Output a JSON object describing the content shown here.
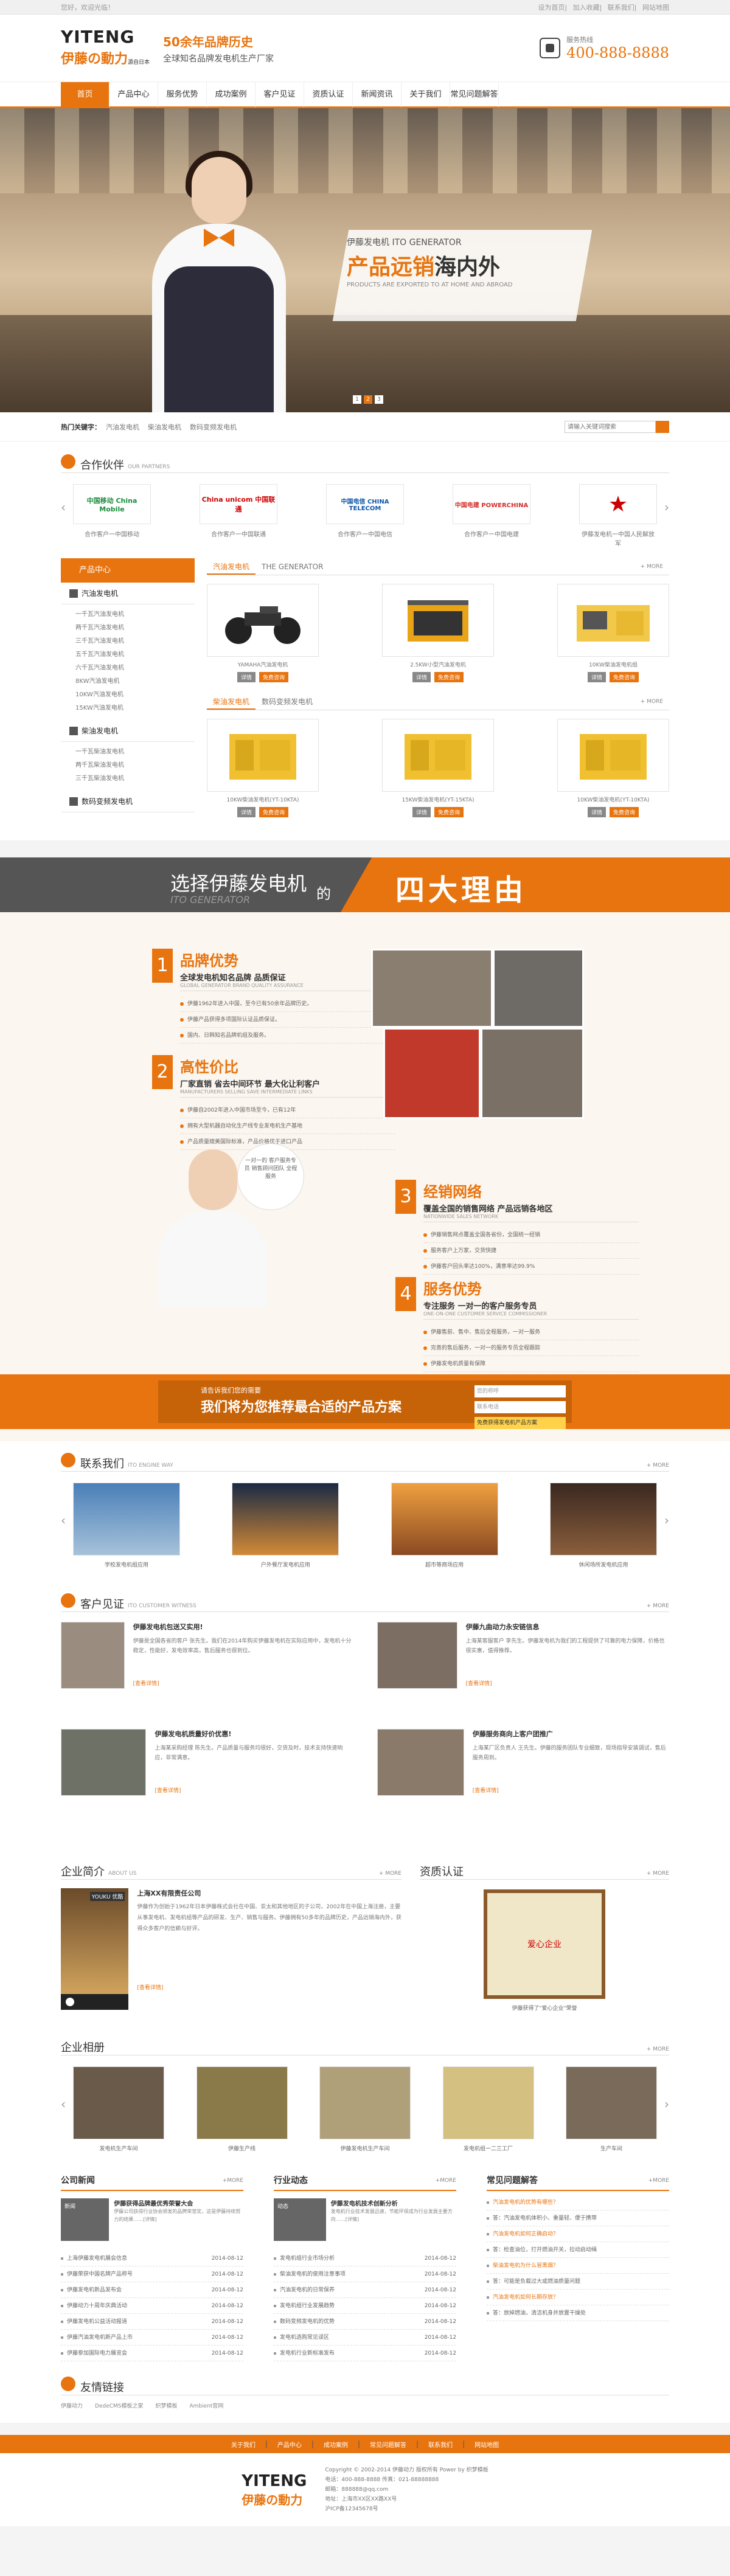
{
  "topbar": {
    "welcome": "您好，欢迎光临！",
    "links": [
      "设为首页",
      "加入收藏",
      "联系我们",
      "网站地图"
    ]
  },
  "header": {
    "logo_en": "YITENG",
    "logo_cn": "伊藤の動力",
    "logo_sub": "源自日本",
    "slogan1": "50余年品牌历史",
    "slogan2": "全球知名品牌发电机生产厂家",
    "tel_label": "服务热线",
    "tel": "400-888-8888"
  },
  "nav": [
    "首页",
    "产品中心",
    "服务优势",
    "成功案例",
    "客户见证",
    "资质认证",
    "新闻资讯",
    "关于我们",
    "常见问题解答"
  ],
  "banner": {
    "small": "伊藤发电机 ITO GENERATOR",
    "big_orange": "产品远销",
    "big_dark": "海内外",
    "en": "PRODUCTS ARE EXPORTED TO AT HOME AND ABROAD",
    "dots": [
      "1",
      "2",
      "3"
    ]
  },
  "hot": {
    "label": "热门关键字：",
    "keywords": [
      "汽油发电机",
      "柴油发电机",
      "数码变频发电机"
    ],
    "placeholder": "请输入关键词搜索"
  },
  "partners": {
    "title": "合作伙伴",
    "en": "OUR PARTNERS",
    "items": [
      {
        "logo": "中国移动 China Mobile",
        "cap": "合作客户一中国移动"
      },
      {
        "logo": "China unicom 中国联通",
        "cap": "合作客户一中国联通"
      },
      {
        "logo": "中国电信 CHINA TELECOM",
        "cap": "合作客户一中国电信"
      },
      {
        "logo": "中国电建 POWERCHINA",
        "cap": "合作客户一中国电建"
      },
      {
        "logo": "★",
        "cap": "伊藤发电机一中国人民解放军"
      }
    ]
  },
  "products": {
    "side_title": "产品中心",
    "cats": [
      {
        "name": "汽油发电机",
        "subs": [
          "一千瓦汽油发电机",
          "两千瓦汽油发电机",
          "三千瓦汽油发电机",
          "五千瓦汽油发电机",
          "六千瓦汽油发电机",
          "8KW汽油发电机",
          "10KW汽油发电机",
          "15KW汽油发电机"
        ]
      },
      {
        "name": "柴油发电机",
        "subs": [
          "一千瓦柴油发电机",
          "两千瓦柴油发电机",
          "三千瓦柴油发电机"
        ]
      },
      {
        "name": "数码变频发电机",
        "subs": []
      }
    ],
    "tab1": "汽油发电机",
    "tab1_en": "THE GENERATOR",
    "tab2": "柴油发电机",
    "tab2b": "数码变频发电机",
    "more": "+ MORE",
    "row1": [
      "YAMAHA汽油发电机",
      "2.5KW小型汽油发电机",
      "10KW柴油发电机组"
    ],
    "row2": [
      "10KW柴油发电机(YT-10KTA)",
      "15KW柴油发电机(YT-15KTA)",
      "10KW柴油发电机(YT-10KTA)"
    ],
    "btn1": "详情",
    "btn2": "免费咨询"
  },
  "reasons": {
    "title1": "选择伊藤发电机",
    "title2": "ITO GENERATOR",
    "de": "的",
    "big": "四大理由",
    "items": [
      {
        "num": "1",
        "title": "品牌优势",
        "sub": "全球发电机知名品牌 品质保证",
        "en": "GLOBAL GENERATOR BRAND QUALITY ASSURANCE",
        "pts": [
          "伊藤1962年进入中国，至今已有50余年品牌历史。",
          "伊藤产品获得多项国际认证品质保证。",
          "国内、日韩知名品牌机组及服务。"
        ]
      },
      {
        "num": "2",
        "title": "高性价比",
        "sub": "厂家直销 省去中间环节 最大化让利客户",
        "en": "MANUFACTURERS SELLING SAVE INTERMEDIATE LINKS",
        "pts": [
          "伊藤自2002年进入中国市场至今，已有12年",
          "拥有大型机器自动化生产线专业发电机生产基地",
          "产品质量媲美国际标准，产品价格优于进口产品"
        ]
      },
      {
        "num": "3",
        "title": "经销网络",
        "sub": "覆盖全国的销售网络 产品远销各地区",
        "en": "NATIONWIDE SALES NETWORK",
        "pts": [
          "伊藤销售网点覆盖全国各省份，全国统一经销",
          "服务客户上万家，交货快捷",
          "伊藤客户回头率达100%，满意率达99.9%"
        ]
      },
      {
        "num": "4",
        "title": "服务优势",
        "sub": "专注服务 一对一的客户服务专员",
        "en": "ONE-ON-ONE CUSTOMER SERVICE COMMISSIONER",
        "pts": [
          "伊藤售前、售中、售后全程服务，一对一服务",
          "完善的售后服务，一对一的服务专员全程跟踪",
          "伊藤发电机质量有保障"
        ]
      }
    ],
    "bubble": "一对一的 客户服务专员 销售顾问团队 全程服务",
    "cta1": "请告诉我们您的需要",
    "cta2": "我们将为您推荐最合适的产品方案",
    "form": [
      "您的称呼",
      "联系电话",
      "免费获得发电机产品方案"
    ]
  },
  "contact": {
    "title": "联系我们",
    "en": "ITO ENGINE WAY",
    "items": [
      "学校发电机组应用",
      "户外餐厅发电机应用",
      "超市等商场应用",
      "休闲场所发电机应用"
    ]
  },
  "testimonials": {
    "title": "客户见证",
    "en": "ITO CUSTOMER WITNESS",
    "items": [
      {
        "t": "伊藤发电机包送又实用!",
        "x": "伊藤是全国各省的客户 张先生。我们在2014年购买伊藤发电机在实际应用中，发电机十分稳定，性能好，发电效率高，售后服务也很到位。",
        "rm": "[查看详情]"
      },
      {
        "t": "伊藤九曲动力永安链信息",
        "x": "上海某客服客户 李先生。伊藤发电机为我们的工程提供了可靠的电力保障，价格也很实惠，值得推荐。",
        "rm": "[查看详情]"
      },
      {
        "t": "伊藤发电机质量好价优惠!",
        "x": "上海某采购经理 陈先生。产品质量与服务均很好，交货及时，技术支持快速响应，非常满意。",
        "rm": "[查看详情]"
      },
      {
        "t": "伊藤服务商向上客户团推广",
        "x": "上海某厂区负责人 王先生。伊藤的服务团队专业细致，现场指导安装调试，售后服务周到。",
        "rm": "[查看详情]"
      }
    ]
  },
  "company": {
    "title": "企业简介",
    "en": "ABOUT US",
    "more": "+ MORE",
    "name": "上海XX有限责任公司",
    "text": "伊藤作为创始于1962年日本伊藤株式会社在中国、亚太和其他地区的子公司，2002年在中国上海注册，主要从事发电机、发电机组等产品的研发、生产、销售与服务。伊藤拥有50多年的品牌历史，产品远销海内外，获得众多客户的信赖与好评。",
    "rm": "[查看详情]",
    "video_tag": "YOUKU 优酷"
  },
  "cert": {
    "title": "资质认证",
    "more": "+ MORE",
    "badge": "爱心企业",
    "cap": "伊藤获得了\"爱心企业\"荣誉"
  },
  "album": {
    "title": "企业相册",
    "more": "+ MORE",
    "items": [
      "发电机生产车间",
      "伊藤生产线",
      "伊藤发电机生产车间",
      "发电机组一二三工厂",
      "生产车间"
    ],
    "sub": "伊藤"
  },
  "news": [
    {
      "title": "公司新闻",
      "more": "+MORE",
      "top_title": "新闻",
      "top_t": "伊藤获得品牌最优秀荣誉大会",
      "top_x": "伊藤公司获得行业协会颁发的品牌荣誉奖，这是伊藤持续努力的结果……[详情]",
      "items": [
        [
          "上海伊藤发电机展会信息",
          "2014-08-12"
        ],
        [
          "伊藤荣获中国名牌产品称号",
          "2014-08-12"
        ],
        [
          "伊藤发电机新品发布会",
          "2014-08-12"
        ],
        [
          "伊藤动力十周年庆典活动",
          "2014-08-12"
        ],
        [
          "伊藤发电机公益活动报道",
          "2014-08-12"
        ],
        [
          "伊藤汽油发电机新产品上市",
          "2014-08-12"
        ],
        [
          "伊藤参加国际电力展览会",
          "2014-08-12"
        ]
      ]
    },
    {
      "title": "行业动态",
      "more": "+MORE",
      "top_title": "动态",
      "top_t": "伊藤发电机技术创新分析",
      "top_x": "发电机行业技术发展迅速，节能环保成为行业发展主要方向……[详情]",
      "items": [
        [
          "发电机组行业市场分析",
          "2014-08-12"
        ],
        [
          "柴油发电机的使用注意事项",
          "2014-08-12"
        ],
        [
          "汽油发电机的日常保养",
          "2014-08-12"
        ],
        [
          "发电机组行业发展趋势",
          "2014-08-12"
        ],
        [
          "数码变频发电机的优势",
          "2014-08-12"
        ],
        [
          "发电机选购常见误区",
          "2014-08-12"
        ],
        [
          "发电机行业新标准发布",
          "2014-08-12"
        ]
      ]
    },
    {
      "title": "常见问题解答",
      "more": "+MORE",
      "items": [
        [
          "汽油发电机的优势有哪些？",
          ""
        ],
        [
          "答：汽油发电机体积小、重量轻、便于携带",
          ""
        ],
        [
          "汽油发电机如何正确启动？",
          ""
        ],
        [
          "答：检查油位，打开燃油开关，拉动启动绳",
          ""
        ],
        [
          "柴油发电机为什么冒黑烟？",
          ""
        ],
        [
          "答：可能是负载过大或燃油质量问题",
          ""
        ],
        [
          "汽油发电机如何长期存放？",
          ""
        ],
        [
          "答：放掉燃油，清洁机身并放置干燥处",
          ""
        ]
      ]
    }
  ],
  "links": {
    "title": "友情链接",
    "items": [
      "伊藤动力",
      "DedeCMS模板之家",
      "织梦模板",
      "Ambient官网"
    ]
  },
  "fnav": [
    "关于我们",
    "产品中心",
    "成功案例",
    "常见问题解答",
    "联系我们",
    "网站地图"
  ],
  "footer": {
    "logo_en": "YITENG",
    "logo_cn": "伊藤の動力",
    "info": [
      "Copyright © 2002-2014 伊藤动力 版权所有 Power by 织梦模板",
      "电话：400-888-8888  传真：021-88888888",
      "邮箱：888888@qq.com",
      "地址：上海市XX区XX路XX号",
      "沪ICP备12345678号"
    ]
  }
}
